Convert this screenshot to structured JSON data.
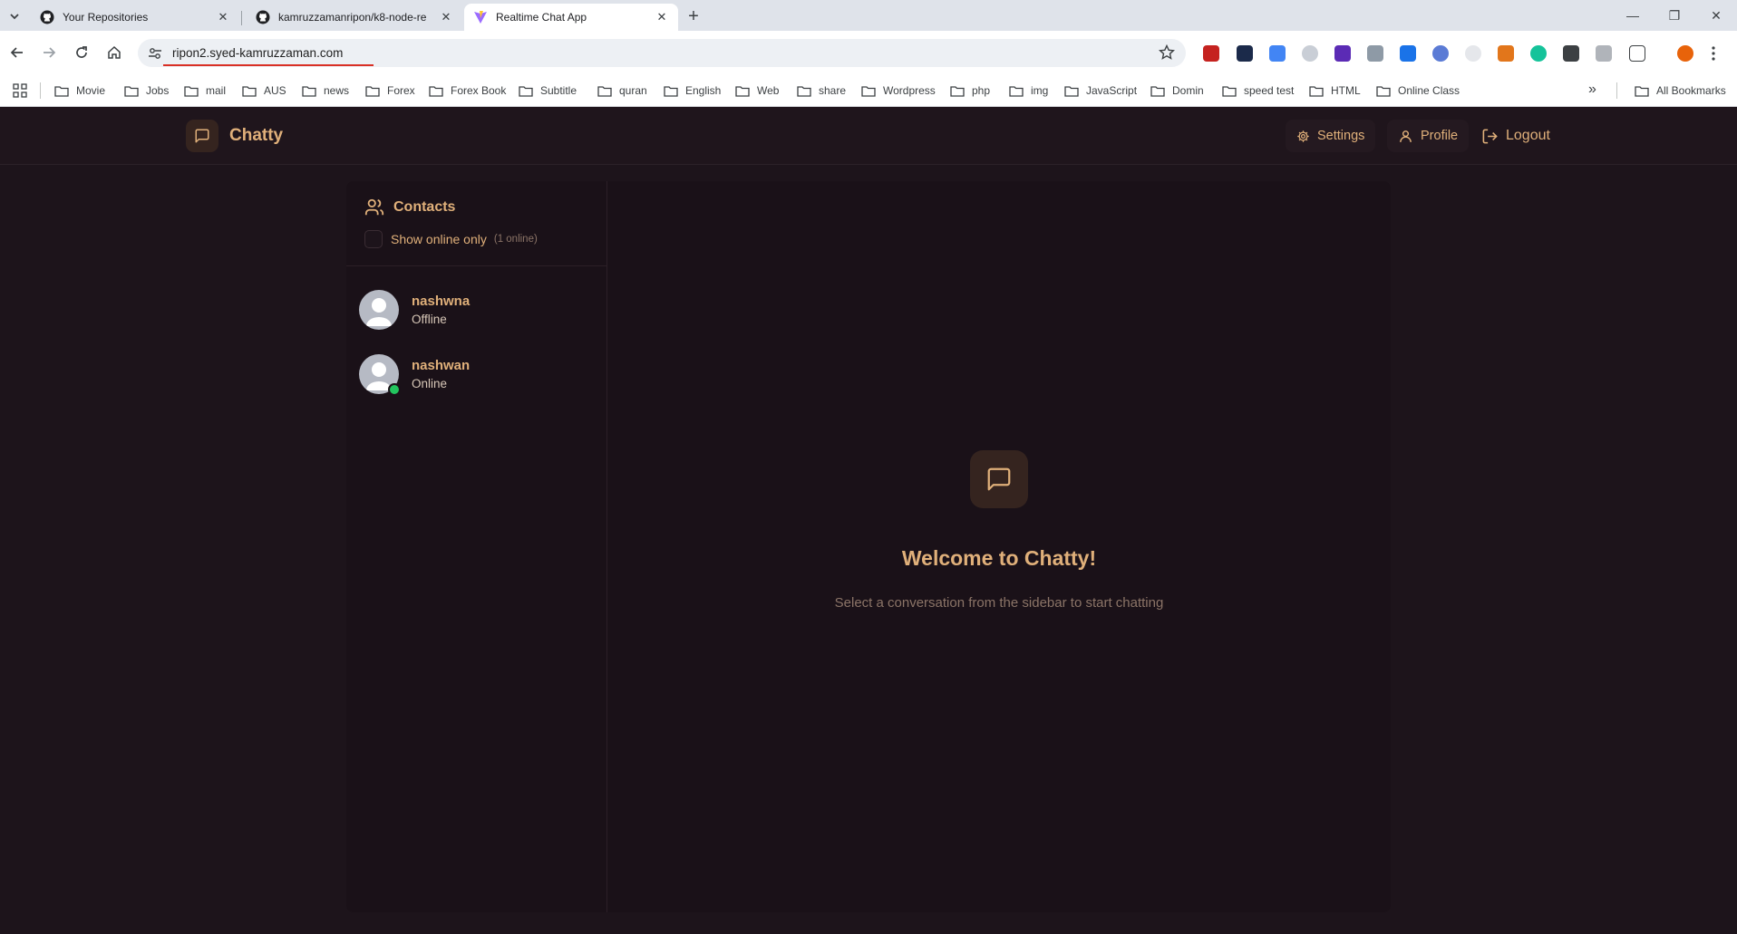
{
  "browser": {
    "tabs": [
      {
        "title": "Your Repositories",
        "icon": "github-icon",
        "active": false
      },
      {
        "title": "kamruzzamanripon/k8-node-re",
        "icon": "github-icon",
        "active": false
      },
      {
        "title": "Realtime Chat App",
        "icon": "vite-icon",
        "active": true
      }
    ],
    "url": "ripon2.syed-kamruzzaman.com",
    "bookmarks": [
      "Movie",
      "Jobs",
      "mail",
      "AUS",
      "news",
      "Forex",
      "Forex Book",
      "Subtitle",
      "quran",
      "English",
      "Web",
      "share",
      "Wordpress",
      "php",
      "img",
      "JavaScript",
      "Domin",
      "speed test",
      "HTML",
      "Online Class"
    ],
    "all_bookmarks": "All Bookmarks"
  },
  "app": {
    "brand": "Chatty",
    "header": {
      "settings": "Settings",
      "profile": "Profile",
      "logout": "Logout"
    },
    "sidebar": {
      "title": "Contacts",
      "filter_label": "Show online only",
      "online_count": "(1 online)",
      "contacts": [
        {
          "name": "nashwna",
          "status": "Offline",
          "online": false
        },
        {
          "name": "nashwan",
          "status": "Online",
          "online": true
        }
      ]
    },
    "empty_state": {
      "title": "Welcome to Chatty!",
      "subtitle": "Select a conversation from the sidebar to start chatting"
    },
    "colors": {
      "background": "#1d141b",
      "accent": "#e0b07a",
      "online": "#22c55e"
    }
  }
}
